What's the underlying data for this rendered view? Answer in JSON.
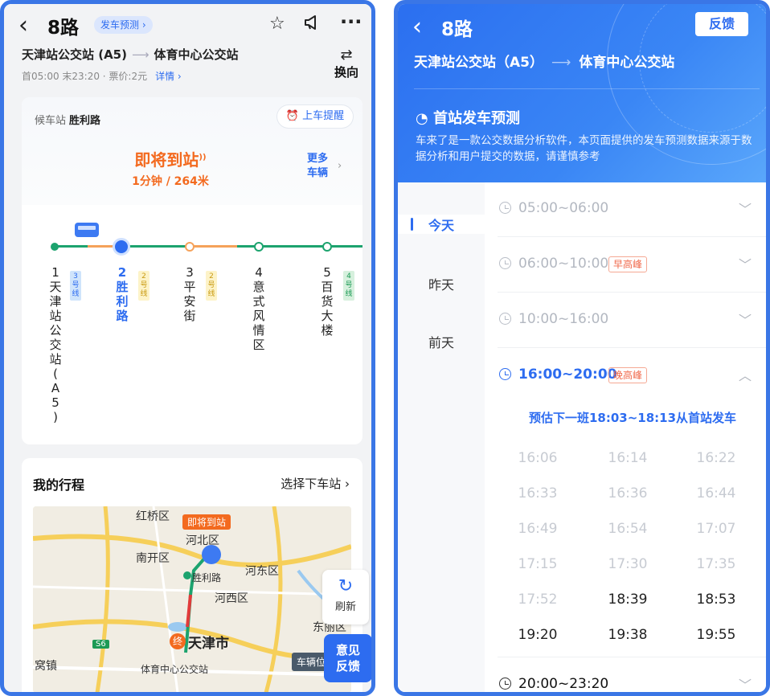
{
  "left": {
    "header": {
      "title": "8路",
      "pred_tag": "发车预测 ›",
      "route_from": "天津站公交站 (A5)",
      "route_arrow": "⟶",
      "route_to": "体育中心公交站",
      "info": "首05:00 末23:20 · 票价:2元",
      "detail_link": "详情 ›",
      "swap_label": "换向"
    },
    "card": {
      "wait_label": "候车站",
      "wait_stop": "胜利路",
      "remind": "上车提醒",
      "arriving": "即将到站",
      "arriving_sub": "1分钟 / 264米",
      "more_vehicles": [
        "更多",
        "车辆"
      ]
    },
    "stops": [
      {
        "num": "1",
        "name": "天津站公交站(A5)",
        "xfer": "3号线",
        "xfer_color": "#cfe4fb",
        "xfer_text": "#2d6cf0"
      },
      {
        "num": "2",
        "name": "胜利路",
        "xfer": "2号线",
        "xfer_color": "#fdf3c8",
        "xfer_text": "#c99a12"
      },
      {
        "num": "3",
        "name": "平安街",
        "xfer": "2号线",
        "xfer_color": "#fdf3c8",
        "xfer_text": "#c99a12"
      },
      {
        "num": "4",
        "name": "意式风情区",
        "xfer": "",
        "xfer_color": "",
        "xfer_text": ""
      },
      {
        "num": "5",
        "name": "百货大楼",
        "xfer": "4号线",
        "xfer_color": "#d6f0dd",
        "xfer_text": "#1c9a55"
      }
    ],
    "trip": {
      "title": "我的行程",
      "select": "选择下车站 ›",
      "map_labels": {
        "hongqiao": "红桥区",
        "arriving_badge": "即将到站",
        "hebei": "河北区",
        "nankai": "南开区",
        "hedong": "河东区",
        "shenglilu": "胜利路",
        "hexi": "河西区",
        "dongli": "东丽区",
        "end": "终",
        "tianjin": "天津市",
        "s6": "S6",
        "wozhen": "窝镇",
        "tiyu": "体育中心公交站",
        "vehicle": "车辆位"
      }
    },
    "refresh": "刷新",
    "feedback": [
      "意见",
      "反馈"
    ]
  },
  "right": {
    "header": {
      "title": "8路",
      "feedback": "反馈",
      "route_from": "天津站公交站（A5）",
      "route_arrow": "⟶",
      "route_to": "体育中心公交站",
      "subtitle": "首站发车预测",
      "desc": "车来了是一款公交数据分析软件，本页面提供的发车预测数据来源于数据分析和用户提交的数据，请谨慎参考"
    },
    "days": [
      "今天",
      "昨天",
      "前天"
    ],
    "periods": [
      {
        "time": "05:00~06:00",
        "peak": ""
      },
      {
        "time": "06:00~10:00",
        "peak": "早高峰"
      },
      {
        "time": "10:00~16:00",
        "peak": ""
      },
      {
        "time": "16:00~20:00",
        "peak": "晚高峰"
      },
      {
        "time": "20:00~23:20",
        "peak": ""
      }
    ],
    "next_info": "预估下一班18:03~18:13从首站发车",
    "times": [
      [
        "16:06",
        "16:14",
        "16:22"
      ],
      [
        "16:33",
        "16:36",
        "16:44"
      ],
      [
        "16:49",
        "16:54",
        "17:07"
      ],
      [
        "17:15",
        "17:30",
        "17:35"
      ],
      [
        "17:52",
        "18:39",
        "18:53"
      ],
      [
        "19:20",
        "19:38",
        "19:55"
      ]
    ]
  }
}
